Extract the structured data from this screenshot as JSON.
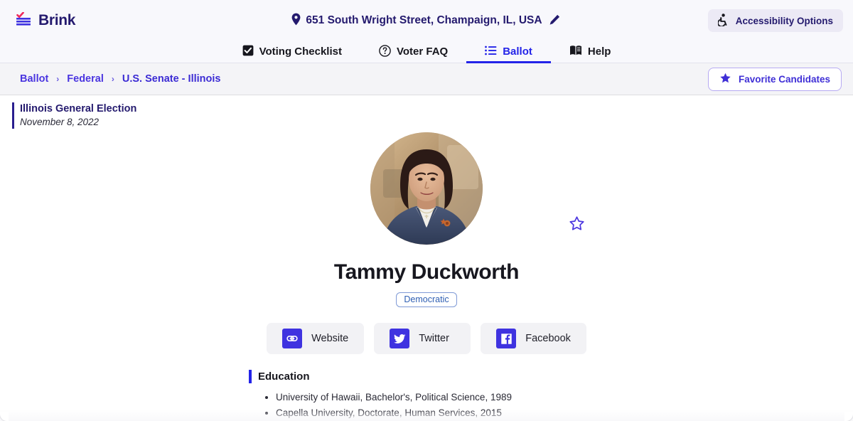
{
  "header": {
    "brand_name": "Brink",
    "brand_icon": "brink-lines-check-logo",
    "address": {
      "pin_icon": "location-pin-icon",
      "text": "651 South Wright Street, Champaign, IL, USA",
      "edit_icon": "pencil-edit-icon"
    },
    "accessibility": {
      "icon": "wheelchair-accessibility-icon",
      "label": "Accessibility Options"
    }
  },
  "tabs": [
    {
      "label": "Voting Checklist",
      "icon": "checkbox-checked-icon",
      "active": false
    },
    {
      "label": "Voter FAQ",
      "icon": "question-circle-icon",
      "active": false
    },
    {
      "label": "Ballot",
      "icon": "list-bullets-icon",
      "active": true
    },
    {
      "label": "Help",
      "icon": "open-book-icon",
      "active": false
    }
  ],
  "breadcrumb": {
    "items": [
      "Ballot",
      "Federal",
      "U.S. Senate - Illinois"
    ],
    "separator": "›",
    "favorites_button": {
      "icon": "star-filled-icon",
      "label": "Favorite Candidates"
    }
  },
  "election": {
    "title": "Illinois General Election",
    "date": "November 8, 2022"
  },
  "favorite_toggle": {
    "icon": "star-outline-icon",
    "state": "off"
  },
  "candidate": {
    "photo_alt": "candidate-portrait",
    "name": "Tammy Duckworth",
    "party": "Democratic",
    "links": [
      {
        "label": "Website",
        "icon": "link-chain-icon"
      },
      {
        "label": "Twitter",
        "icon": "twitter-bird-icon"
      },
      {
        "label": "Facebook",
        "icon": "facebook-f-icon"
      }
    ],
    "sections": [
      {
        "heading": "Education",
        "items": [
          "University of Hawaii, Bachelor's, Political Science, 1989",
          "Capella University, Doctorate, Human Services, 2015"
        ]
      }
    ]
  },
  "colors": {
    "brand_indigo": "#241a6e",
    "accent_blue": "#2323e8",
    "link_violet": "#4a35e0",
    "party_blue": "#2f5fb3",
    "logo_red": "#f0295c",
    "header_bg": "#f8f8fc",
    "crumbbar_bg": "#f4f4f7"
  }
}
